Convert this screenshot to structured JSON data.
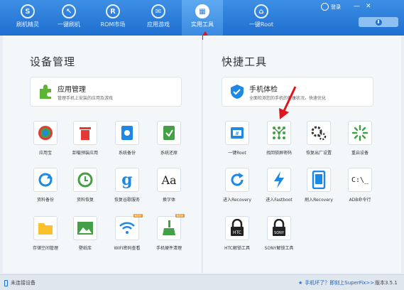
{
  "nav": [
    {
      "label": "刷机精灵",
      "icon": "shield-icon"
    },
    {
      "label": "一键刷机",
      "icon": "cursor-icon"
    },
    {
      "label": "ROM市场",
      "icon": "r-icon"
    },
    {
      "label": "应用游戏",
      "icon": "mail-icon"
    },
    {
      "label": "实用工具",
      "icon": "grid-icon",
      "active": true
    },
    {
      "label": "一键Root",
      "icon": "root-icon"
    }
  ],
  "header": {
    "login": "登录",
    "minimize": "—",
    "close": "✕",
    "download_glyph": "⬇"
  },
  "left": {
    "title": "设备管理",
    "card": {
      "title": "应用管理",
      "subtitle": "管理手机上安装的应用及游戏"
    },
    "tiles": [
      {
        "label": "应用宝"
      },
      {
        "label": "卸载预装应用"
      },
      {
        "label": "系统备份"
      },
      {
        "label": "系统还原"
      },
      {
        "label": "资料备份"
      },
      {
        "label": "资料恢复"
      },
      {
        "label": "恢复谷歌服务"
      },
      {
        "label": "换字体"
      },
      {
        "label": "存储空间管理"
      },
      {
        "label": "壁纸库"
      },
      {
        "label": "WIFI密码查看",
        "badge": "NEW"
      },
      {
        "label": "手机硬件清理",
        "badge": "NEW"
      }
    ]
  },
  "right": {
    "title": "快捷工具",
    "card": {
      "title": "手机体检",
      "subtitle": "全面检测您的手机的健康状况，快速优化"
    },
    "tiles": [
      {
        "label": "一键Root"
      },
      {
        "label": "找回锁屏密码"
      },
      {
        "label": "恢复出厂设置"
      },
      {
        "label": "重启设备"
      },
      {
        "label": "进入Recovery"
      },
      {
        "label": "进入Fastboot"
      },
      {
        "label": "刷入Recovery"
      },
      {
        "label": "ADB命令行"
      },
      {
        "label": "HTC解锁工具"
      },
      {
        "label": "SONY解锁工具"
      }
    ]
  },
  "status": {
    "connection": "未连接设备",
    "help": "手机坏了？即刻上SuperFix>>",
    "version": "版本3.5.1"
  },
  "icon_text": {
    "font_glyph": "Aa",
    "adb_glyph": "C:\\_",
    "htc": "HTC",
    "sony": "SONY"
  },
  "colors": {
    "accent": "#1e6fd0",
    "arrow": "#e0141e",
    "badge": "#f7941d"
  }
}
